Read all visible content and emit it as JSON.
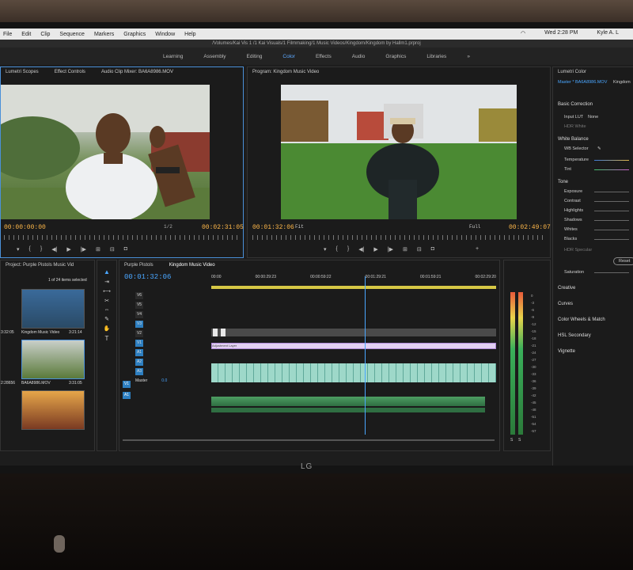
{
  "menubar": {
    "apple": "",
    "items": [
      "File",
      "Edit",
      "Clip",
      "Sequence",
      "Markers",
      "Graphics",
      "Window",
      "Help"
    ],
    "status_right": [
      "Wed 2:28 PM",
      "Kyle A. L"
    ]
  },
  "path_title": "/Volumes/Kai Vis 1 /1 Kai Visuals/1 Filmmaking/1 Music Videos/Kingdom/Kingdom by Hallm1.prproj",
  "workspaces": {
    "items": [
      "Learning",
      "Assembly",
      "Editing",
      "Color",
      "Effects",
      "Audio",
      "Graphics",
      "Libraries"
    ],
    "active_index": 3,
    "more": "»"
  },
  "source_panel": {
    "tabs": [
      "Lumetri Scopes",
      "Effect Controls",
      "Audio Clip Mixer: BA6A8986.MOV"
    ],
    "timecode_left": "00:00:00:00",
    "fraction": "1/2",
    "timecode_right": "00:02:31:05"
  },
  "program_panel": {
    "title": "Program: Kingdom Music Video",
    "timecode_left": "00:01:32:06",
    "fit": "Fit",
    "quality": "Full",
    "timecode_right": "00:02:49:07"
  },
  "lumetri": {
    "title": "Lumetri Color",
    "master": "Master * BA6A8986.MOV",
    "sequence": "Kingdom",
    "basic_correction": "Basic Correction",
    "input_lut_label": "Input LUT",
    "input_lut_value": "None",
    "hdr_white": "HDR White",
    "white_balance": "White Balance",
    "wb_selector": "WB Selector",
    "temperature": "Temperature",
    "tint": "Tint",
    "tone": "Tone",
    "tone_rows": [
      "Exposure",
      "Contrast",
      "Highlights",
      "Shadows",
      "Whites",
      "Blacks"
    ],
    "hdr_specular": "HDR Specular",
    "reset": "Reset",
    "saturation": "Saturation",
    "sections": [
      "Creative",
      "Curves",
      "Color Wheels & Match",
      "HSL Secondary",
      "Vignette"
    ]
  },
  "project": {
    "title": "Project: Purple Pistols Music Vid",
    "count": "1 of 24 items selected",
    "items": [
      {
        "name": "Kingdom Music Video",
        "dur": "3:21:14"
      },
      {
        "name": "BA6A8986.MOV",
        "dur": "3:31:05"
      }
    ],
    "left_labels": [
      "3:32:05",
      "2:28656"
    ]
  },
  "timeline": {
    "tabs": [
      "Purple Pistols",
      "Kingdom Music Video"
    ],
    "timecode": "00:01:32:06",
    "ruler": [
      "00:00",
      "00:00:29:23",
      "00:00:59:22",
      "00:01:29:21",
      "00:01:59:21",
      "00:02:29:20"
    ],
    "video_tracks": [
      "V6",
      "V5",
      "V4",
      "V3",
      "V2",
      "V1"
    ],
    "audio_tracks": [
      "A1",
      "A2",
      "A3"
    ],
    "master": "Master",
    "master_val": "0.0",
    "side_labels": [
      "V1",
      "A1"
    ],
    "adjustment_layer": "Adjustment Layer"
  },
  "meter": {
    "scale": [
      "0",
      "-3",
      "-6",
      "-9",
      "-12",
      "-15",
      "-18",
      "-21",
      "-24",
      "-27",
      "-30",
      "-33",
      "-36",
      "-39",
      "-42",
      "-45",
      "-48",
      "-51",
      "-54",
      "-57"
    ],
    "bottom": [
      "S",
      "S"
    ]
  },
  "monitor_brand": "LG"
}
